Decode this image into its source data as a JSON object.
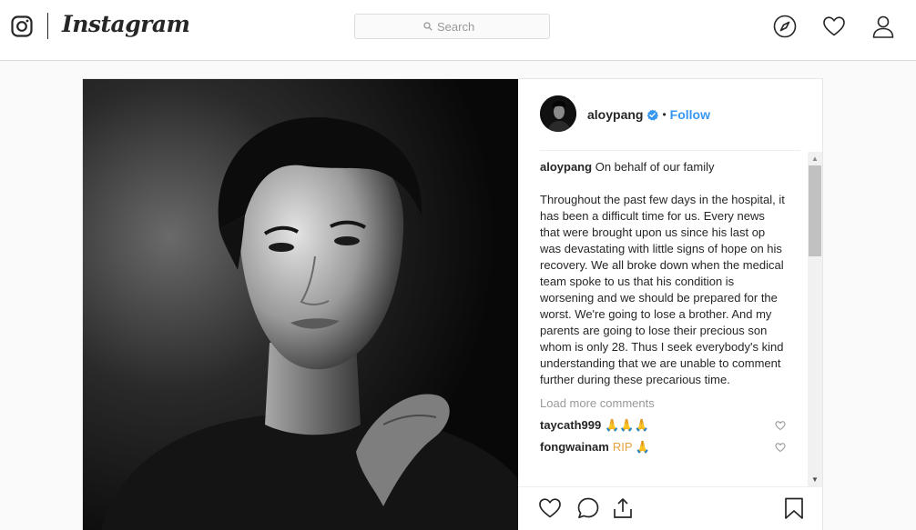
{
  "nav": {
    "logo_text": "Instagram",
    "search_placeholder": "Search",
    "icons": [
      "instagram-glyph-icon",
      "compass-icon",
      "heart-icon",
      "profile-icon"
    ]
  },
  "post": {
    "author": {
      "username": "aloypang",
      "verified": true,
      "separator": "•",
      "follow_label": "Follow"
    },
    "caption": {
      "username": "aloypang",
      "first_line": "On behalf of our family",
      "body": "Throughout the past few days in the hospital, it has been a difficult time for us. Every news that were brought upon us since his last op was devastating with little signs of hope on his recovery. We all broke down when the medical team spoke to us that his condition is worsening and we should be prepared for the worst. We're going to lose a brother. And my parents are going to lose their precious son whom is only 28. Thus I seek everybody's kind understanding that we are unable to comment further during these precarious time."
    },
    "load_more_label": "Load more comments",
    "comments": [
      {
        "username": "taycath999",
        "text": "🙏🙏🙏"
      },
      {
        "username": "fongwainam",
        "text": "RIP 🙏"
      }
    ],
    "action_icons": [
      "heart-icon",
      "comment-icon",
      "share-icon",
      "bookmark-icon"
    ]
  },
  "colors": {
    "link_blue": "#3897f0",
    "text_dark": "#262626",
    "muted_gray": "#999999",
    "border": "#dbdbdb",
    "page_bg": "#fafafa"
  }
}
